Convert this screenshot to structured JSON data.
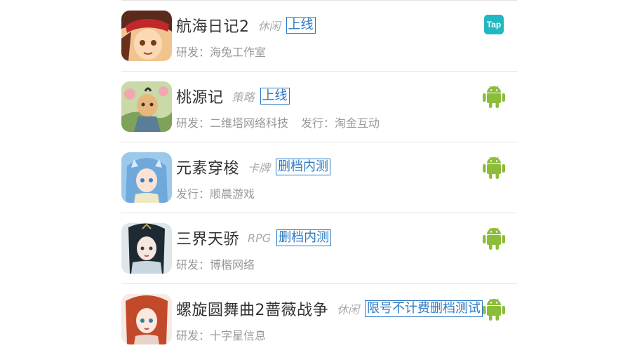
{
  "games": [
    {
      "name": "航海日记2",
      "genre": "休闲",
      "status": "上线",
      "meta": [
        {
          "label": "研发：海兔工作室"
        }
      ],
      "platform": "taptap",
      "platform_label": "Tap"
    },
    {
      "name": "桃源记",
      "genre": "策略",
      "status": "上线",
      "meta": [
        {
          "label": "研发：二维塔网络科技"
        },
        {
          "label": "发行：淘金互动"
        }
      ],
      "platform": "android"
    },
    {
      "name": "元素穿梭",
      "genre": "卡牌",
      "status": "删档内测",
      "meta": [
        {
          "label": "发行：顺晨游戏"
        }
      ],
      "platform": "android"
    },
    {
      "name": "三界天骄",
      "genre": "RPG",
      "status": "删档内测",
      "meta": [
        {
          "label": "研发：博楷网络"
        }
      ],
      "platform": "android"
    },
    {
      "name": "螺旋圆舞曲2蔷薇战争",
      "genre": "休闲",
      "status": "限号不计费删档测试",
      "meta": [
        {
          "label": "研发：十字星信息"
        }
      ],
      "platform": "android"
    }
  ],
  "colors": {
    "android": "#8cbd3a",
    "taptap": "#1fb8c3",
    "status": "#2a79c4"
  }
}
